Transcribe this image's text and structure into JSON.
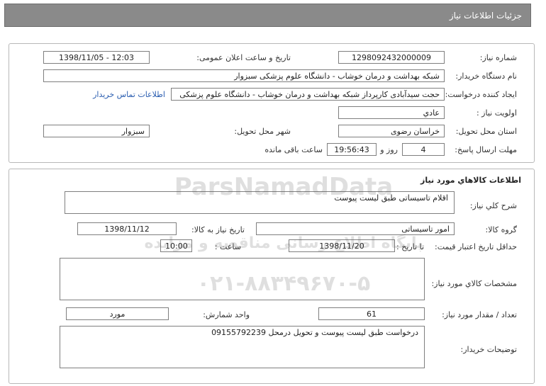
{
  "header": {
    "title": "جزئیات اطلاعات نیاز"
  },
  "info": {
    "need_number_label": "شماره نیاز:",
    "need_number": "1298092432000009",
    "announce_label": "تاریخ و ساعت اعلان عمومی:",
    "announce_value": "1398/11/05 - 12:03",
    "buyer_label": "نام دستگاه خریدار:",
    "buyer_value": "شبکه بهداشت و درمان خوشاب - دانشگاه علوم پزشکی سبزوار",
    "creator_label": "ایجاد کننده درخواست:",
    "creator_value": "حجت سیدآبادی کارپرداز شبکه بهداشت و درمان خوشاب - دانشگاه علوم پزشکی",
    "contact_link": "اطلاعات تماس خریدار",
    "priority_label": "اولویت نیاز :",
    "priority_value": "عادي",
    "province_label": "استان محل تحویل:",
    "province_value": "خراسان رضوی",
    "city_label": "شهر محل تحویل:",
    "city_value": "سبزوار",
    "deadline_label": "مهلت ارسال پاسخ:",
    "days_value": "4",
    "days_word": "روز و",
    "time_value": "19:56:43",
    "remaining_text": "ساعت باقی مانده"
  },
  "goods": {
    "section_title": "اطلاعات کالاهاي مورد نیاز",
    "summary_label": "شرح کلي نیاز:",
    "summary_value": "اقلام تاسیساتی طبق لیست پیوست",
    "group_label": "گروه کالا:",
    "group_value": "امور تاسیساتی",
    "need_date_label": "تاریخ نیاز به کالا:",
    "need_date_value": "1398/11/12",
    "validity_label": "حداقل تاریخ اعتبار قیمت:",
    "until_date_label": "تا تاریخ :",
    "until_date_value": "1398/11/20",
    "hour_label": "ساعت :",
    "hour_value": "10:00",
    "specs_label": "مشخصات کالاي مورد نیاز:",
    "specs_value": "",
    "qty_label": "تعداد / مقدار مورد نیاز:",
    "qty_value": "61",
    "unit_label": "واحد شمارش:",
    "unit_value": "مورد",
    "notes_label": "توضیحات خریدار:",
    "notes_value": "درخواست طبق لیست پیوست و تحویل درمحل 09155792239"
  },
  "watermark": {
    "line1": "ParsNamadData",
    "line2": "پایگاه اطلاع رسانی مناقصه و مزایده",
    "line3": "۰۲۱-۸۸۳۴۹۶۷۰-۵"
  }
}
